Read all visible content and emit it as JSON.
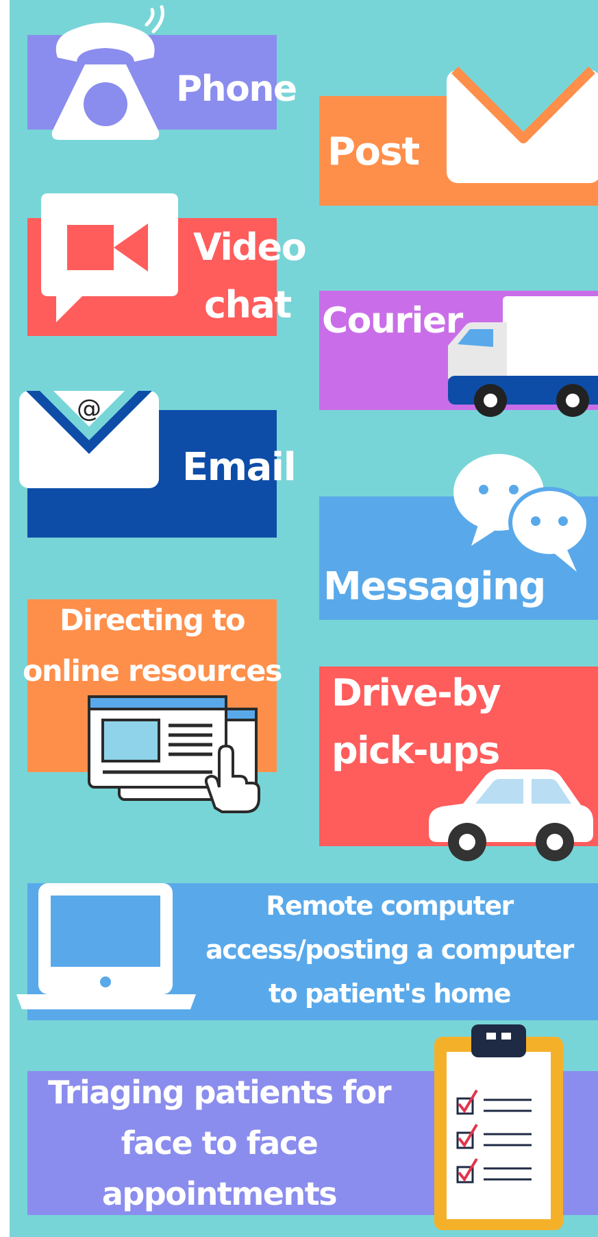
{
  "colors": {
    "background": "#78d5d7",
    "purple": "#8a8ded",
    "orange": "#fe8f4b",
    "red": "#ff5c5c",
    "violet": "#c96ee8",
    "navy": "#0d4da8",
    "blue": "#59a9ea",
    "white": "#ffffff"
  },
  "items": [
    {
      "id": "phone",
      "label": "Phone",
      "icon": "phone-icon"
    },
    {
      "id": "post",
      "label": "Post",
      "icon": "envelope-icon"
    },
    {
      "id": "video",
      "label_line1": "Video",
      "label_line2": "chat",
      "icon": "video-chat-icon"
    },
    {
      "id": "courier",
      "label": "Courier",
      "icon": "delivery-truck-icon"
    },
    {
      "id": "email",
      "label": "Email",
      "icon": "email-envelope-icon",
      "icon_glyph": "@"
    },
    {
      "id": "messaging",
      "label": "Messaging",
      "icon": "chat-bubbles-icon"
    },
    {
      "id": "directing",
      "label_line1": "Directing to",
      "label_line2": "online resources",
      "icon": "browser-window-click-icon"
    },
    {
      "id": "driveby",
      "label_line1": "Drive-by",
      "label_line2": "pick-ups",
      "icon": "car-icon"
    },
    {
      "id": "remote",
      "label_line1": "Remote computer",
      "label_line2": "access/posting a computer",
      "label_line3": "to patient's home",
      "icon": "laptop-icon"
    },
    {
      "id": "triage",
      "label_line1": "Triaging patients for",
      "label_line2": "face to face",
      "label_line3": "appointments",
      "icon": "clipboard-checklist-icon"
    }
  ]
}
